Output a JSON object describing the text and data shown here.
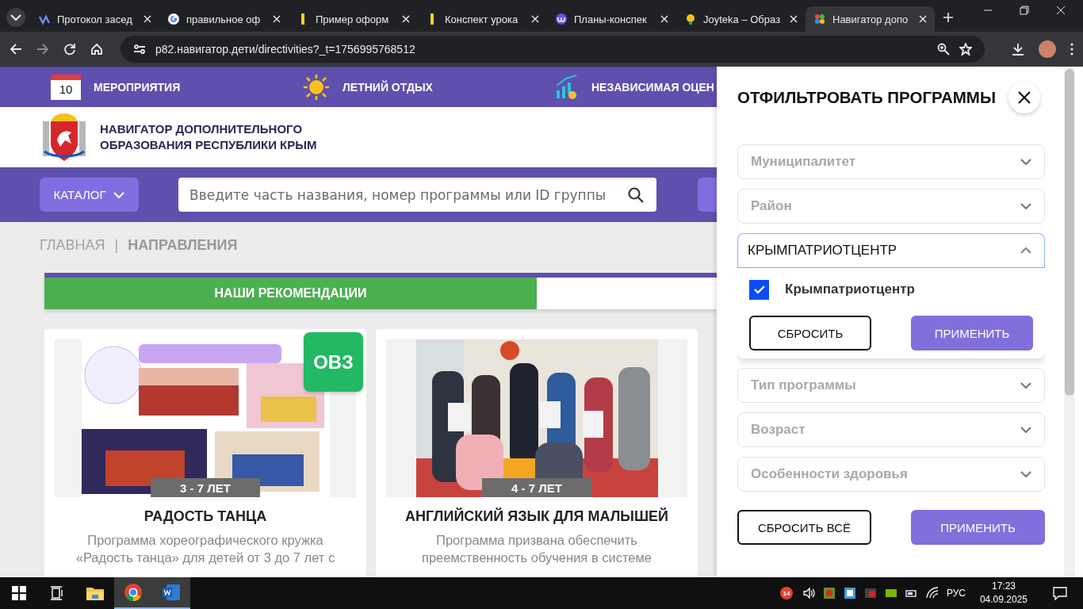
{
  "browser": {
    "tabs": [
      {
        "title": "Протокол засед",
        "selected": false
      },
      {
        "title": "правильное оф",
        "selected": false
      },
      {
        "title": "Пример оформ",
        "selected": false
      },
      {
        "title": "Конспект урока",
        "selected": false
      },
      {
        "title": "Планы-конспек",
        "selected": false
      },
      {
        "title": "Joyteka – Образ",
        "selected": false
      },
      {
        "title": "Навигатор допо",
        "selected": true
      }
    ],
    "address": "p82.навигатор.дети/directivities?_t=1756995768512"
  },
  "site": {
    "top_nav": [
      {
        "label": "МЕРОПРИЯТИЯ",
        "calendar_day": "10"
      },
      {
        "label": "ЛЕТНИЙ ОТДЫХ"
      },
      {
        "label": "НЕЗАВИСИМАЯ ОЦЕН"
      }
    ],
    "logo_lines": [
      "НАВИГАТОР ДОПОЛНИТЕЛЬНОГО",
      "ОБРАЗОВАНИЯ РЕСПУБЛИКИ КРЫМ"
    ],
    "catalog_button": "КАТАЛОГ",
    "search": {
      "placeholder": "Введите часть названия, номер программы или ID группы"
    },
    "breadcrumbs": [
      {
        "label": "ГЛАВНАЯ",
        "selected": false
      },
      {
        "label": "НАПРАВЛЕНИЯ",
        "selected": true
      }
    ],
    "breadcrumb_separator": "|",
    "recommend_tabs": [
      {
        "label": "НАШИ РЕКОМЕНДАЦИИ",
        "selected": true
      }
    ],
    "cards": [
      {
        "badge": "ОВЗ",
        "age": "3 - 7 ЛЕТ",
        "title": "РАДОСТЬ ТАНЦА",
        "description_lines": [
          "Программа хореографического кружка",
          "«Радость танца» для детей от 3 до 7 лет с"
        ]
      },
      {
        "age": "4 - 7 ЛЕТ",
        "title": "АНГЛИЙСКИЙ ЯЗЫК ДЛЯ МАЛЫШЕЙ",
        "description_lines": [
          "Программа призвана обеспечить",
          "преемственность обучения в системе"
        ]
      }
    ]
  },
  "filter": {
    "title": "ОТФИЛЬТРОВАТЬ ПРОГРАММЫ",
    "fields": [
      {
        "placeholder": "Муниципалитет",
        "expanded": false
      },
      {
        "placeholder": "Район",
        "expanded": false
      },
      {
        "value": "КРЫМПАТРИОТЦЕНТР",
        "expanded": true,
        "options": [
          {
            "label": "Крымпатриотцентр",
            "checked": true
          }
        ],
        "reset": "СБРОСИТЬ",
        "apply": "ПРИМЕНИТЬ"
      },
      {
        "placeholder": "Тип программы",
        "expanded": false
      },
      {
        "placeholder": "Возраст",
        "expanded": false
      },
      {
        "placeholder": "Особенности здоровья",
        "expanded": false
      }
    ],
    "reset_all": "СБРОСИТЬ ВСЁ",
    "apply": "ПРИМЕНИТЬ"
  },
  "taskbar": {
    "notification_count": "14",
    "language": "РУС",
    "time": "17:23",
    "date": "04.09.2025"
  }
}
